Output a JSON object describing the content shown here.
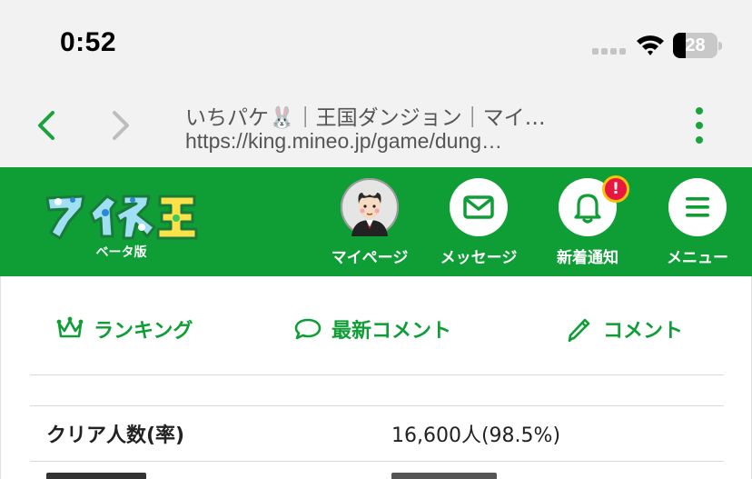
{
  "status_bar": {
    "time": "0:52",
    "battery_level": "28",
    "battery_fraction": 0.28
  },
  "browser": {
    "page_title": "いちパケ🐰｜王国ダンジョン｜マイ…",
    "url": "https://king.mineo.jp/game/dung…"
  },
  "header": {
    "logo_subtitle": "ベータ版",
    "items": [
      {
        "label": "マイページ",
        "icon": "avatar"
      },
      {
        "label": "メッセージ",
        "icon": "envelope-icon"
      },
      {
        "label": "新着通知",
        "icon": "bell-icon",
        "badge": "!"
      },
      {
        "label": "メニュー",
        "icon": "hamburger-icon"
      }
    ]
  },
  "sub_nav": {
    "items": [
      {
        "label": "ランキング",
        "icon": "crown-icon"
      },
      {
        "label": "最新コメント",
        "icon": "speech-bubble-icon"
      },
      {
        "label": "コメント",
        "icon": "pencil-icon"
      }
    ]
  },
  "stats": [
    {
      "label": "クリア人数(率)",
      "value": "16,600人(98.5%)"
    }
  ],
  "colors": {
    "brand_green": "#0e9e35",
    "link_green": "#1aa33c",
    "badge_red": "#e8173f",
    "badge_ring": "#f7c10c"
  }
}
